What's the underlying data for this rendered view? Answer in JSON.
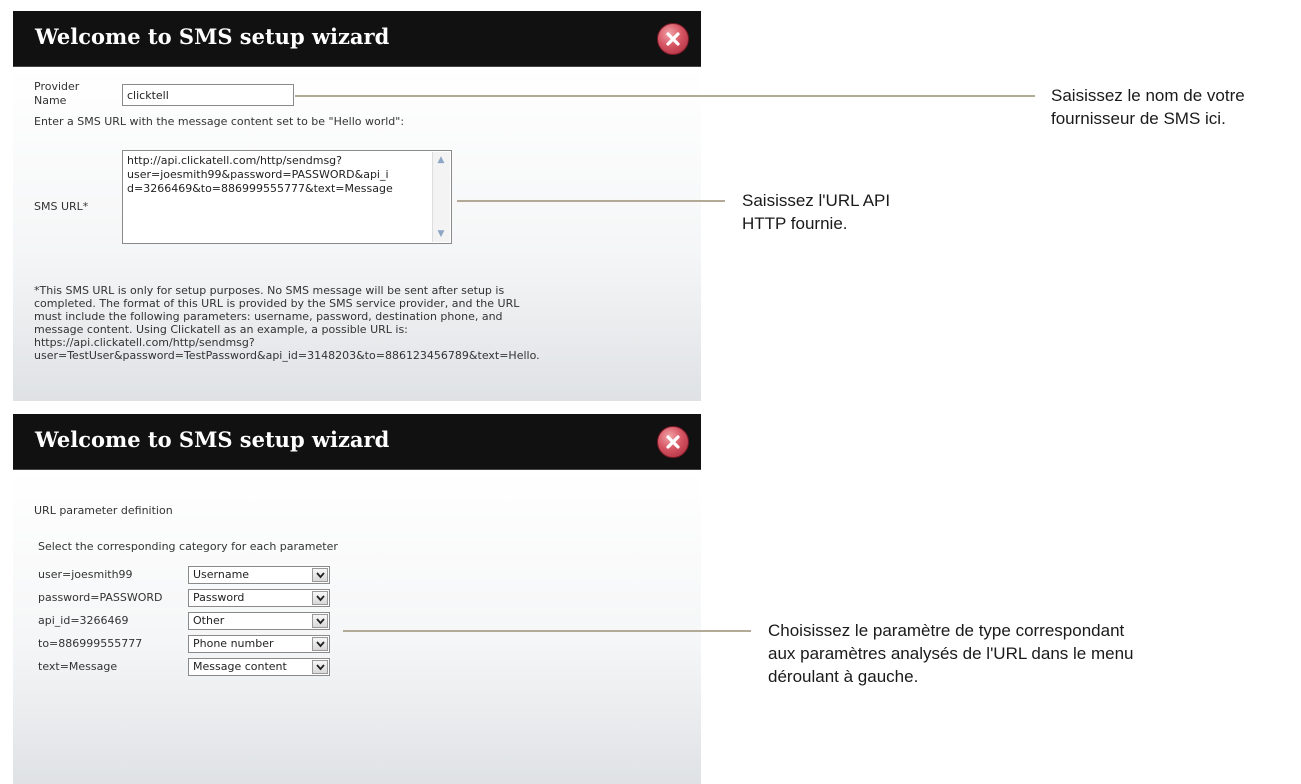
{
  "dialog1": {
    "title": "Welcome to SMS setup wizard",
    "provider_label_line1": "Provider",
    "provider_label_line2": "Name",
    "provider_value": "clicktell",
    "instruction": "Enter a SMS URL with the message content set to be \"Hello world\":",
    "sms_url_label": "SMS URL*",
    "sms_url_lines": [
      "http://api.clickatell.com/http/sendmsg?",
      "user=joesmith99&password=PASSWORD&api_i",
      "d=3266469&to=886999555777&text=Message"
    ],
    "note_lines": [
      "*This SMS URL is only for setup purposes. No SMS message will be sent after setup is",
      "completed. The format of this URL is provided by the SMS service provider, and the URL",
      "must include the following parameters: username, password, destination phone, and",
      "message content. Using Clickatell as an example, a possible URL is:",
      "https://api.clickatell.com/http/sendmsg?",
      "user=TestUser&password=TestPassword&api_id=3148203&to=886123456789&text=Hello."
    ]
  },
  "dialog2": {
    "title": "Welcome to SMS setup wizard",
    "section_title": "URL parameter definition",
    "instruction": "Select the corresponding category for each parameter",
    "params": [
      {
        "name": "user=joesmith99",
        "category": "Username"
      },
      {
        "name": "password=PASSWORD",
        "category": "Password"
      },
      {
        "name": "api_id=3266469",
        "category": "Other"
      },
      {
        "name": "to=886999555777",
        "category": "Phone number"
      },
      {
        "name": "text=Message",
        "category": "Message content"
      }
    ]
  },
  "callouts": {
    "provider_line1": "Saisissez le nom de votre",
    "provider_line2": "fournisseur de SMS ici.",
    "url_line1": "Saisissez l'URL API",
    "url_line2": "HTTP fournie.",
    "param_line1": "Choisissez le paramètre de type correspondant",
    "param_line2": "aux paramètres analysés de l'URL dans le menu",
    "param_line3": "déroulant à gauche."
  },
  "colors": {
    "titlebar": "#111111",
    "close_button": "#d65563",
    "callout_line": "#b3a997"
  },
  "icons": [
    "close-icon",
    "scroll-up-icon",
    "scroll-down-icon",
    "chevron-down-icon"
  ]
}
